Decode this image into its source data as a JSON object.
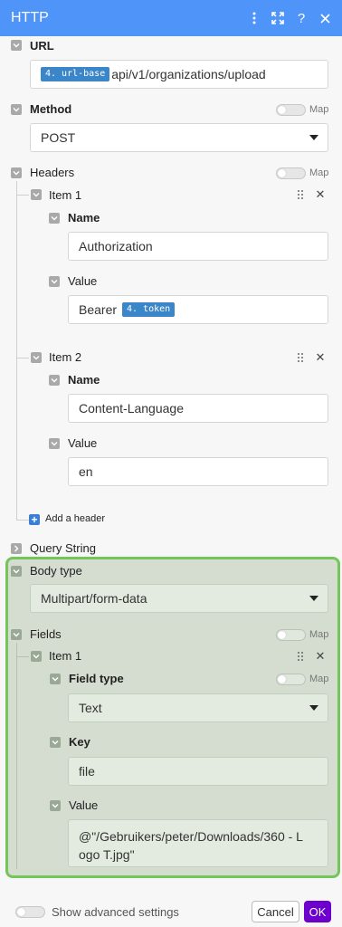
{
  "window": {
    "title": "HTTP",
    "icons": [
      "more-vertical-icon",
      "expand-icon",
      "help-icon",
      "close-icon"
    ]
  },
  "form": {
    "url_label": "URL",
    "url_pill": "4. url-base",
    "url_text": "api/v1/organizations/upload",
    "method_label": "Method",
    "method_value": "POST",
    "map_label": "Map",
    "headers_label": "Headers",
    "header_items": [
      {
        "label": "Item 1",
        "name_label": "Name",
        "name_value": "Authorization",
        "value_label": "Value",
        "value_text": "Bearer",
        "value_pill": "4. token"
      },
      {
        "label": "Item 2",
        "name_label": "Name",
        "name_value": "Content-Language",
        "value_label": "Value",
        "value_text": "en"
      }
    ],
    "add_header_label": "Add a header",
    "query_string_label": "Query String",
    "body_type_label": "Body type",
    "body_type_value": "Multipart/form-data",
    "fields_label": "Fields",
    "field_item": {
      "label": "Item 1",
      "field_type_label": "Field type",
      "field_type_value": "Text",
      "key_label": "Key",
      "key_value": "file",
      "value_label": "Value",
      "value_line1": "@\"/Gebruikers/peter/Downloads/360 - L",
      "value_line2": "ogo T.jpg\""
    }
  },
  "footer": {
    "advanced_label": "Show advanced settings",
    "cancel_label": "Cancel",
    "ok_label": "OK"
  },
  "colors": {
    "titlebar": "#4f94f8",
    "highlight_border": "#74c65b",
    "ok_button": "#6d00cc",
    "pill": "#3a86c8"
  }
}
